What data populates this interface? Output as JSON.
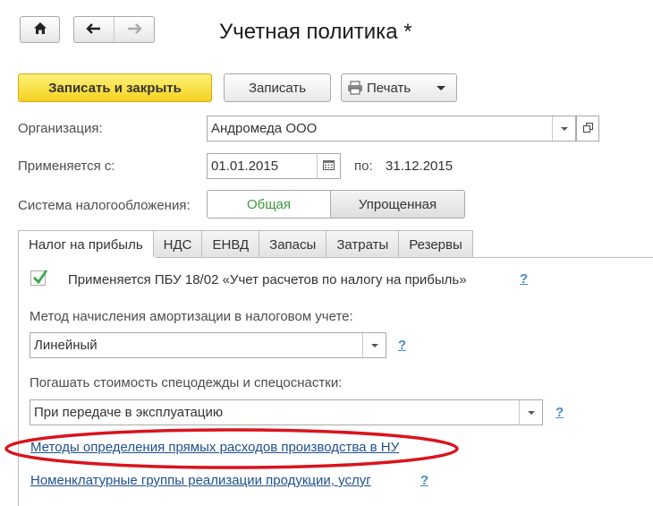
{
  "window": {
    "title": "Учетная политика *"
  },
  "nav": {
    "home_icon": "home-icon",
    "back_icon": "arrow-left-icon",
    "forward_icon": "arrow-right-icon"
  },
  "toolbar": {
    "save_close_label": "Записать и закрыть",
    "save_label": "Записать",
    "print_label": "Печать"
  },
  "form": {
    "organization_label": "Организация:",
    "organization_value": "Андромеда ООО",
    "applies_from_label": "Применяется с:",
    "applies_from_value": "01.01.2015",
    "to_label": "по:",
    "to_value": "31.12.2015",
    "tax_system_label": "Система налогообложения:",
    "tax_system_options": [
      "Общая",
      "Упрощенная"
    ],
    "tax_system_selected": "Общая"
  },
  "tabs": [
    {
      "label": "Налог на прибыль",
      "active": true
    },
    {
      "label": "НДС",
      "active": false
    },
    {
      "label": "ЕНВД",
      "active": false
    },
    {
      "label": "Запасы",
      "active": false
    },
    {
      "label": "Затраты",
      "active": false
    },
    {
      "label": "Резервы",
      "active": false
    }
  ],
  "profit_tax": {
    "pbu_checkbox_label": "Применяется ПБУ 18/02 «Учет расчетов по налогу на прибыль»",
    "pbu_checked": true,
    "amortization_label": "Метод начисления амортизации в налоговом учете:",
    "amortization_value": "Линейный",
    "workwear_label": "Погашать стоимость спецодежды и спецоснастки:",
    "workwear_value": "При передаче в эксплуатацию",
    "direct_costs_link": "Методы определения прямых расходов производства в НУ",
    "nomenclature_link": "Номенклатурные группы реализации продукции, услуг",
    "help_mark": "?"
  },
  "colors": {
    "primary_button": "#f5d21f",
    "highlight_ellipse": "#d9141e",
    "link": "#1f4f8f",
    "help": "#4a88c7",
    "checkmark": "#3aa54a",
    "selected_segment_text": "#3a9a3a"
  }
}
